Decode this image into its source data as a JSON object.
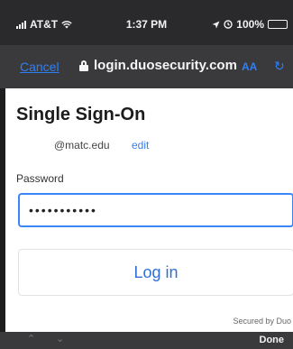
{
  "status_bar": {
    "carrier": "AT&T",
    "time": "1:37 PM",
    "battery": "100%"
  },
  "nav_bar": {
    "cancel_label": "Cancel",
    "url": "login.duosecurity.com",
    "text_size_label": "AA",
    "reload_icon": "↻"
  },
  "form": {
    "title": "Single Sign-On",
    "email": "@matc.edu",
    "edit_label": "edit",
    "password_label": "Password",
    "password_value": "•••••••••••",
    "login_label": "Log in",
    "secured_text": "Secured by Duo"
  },
  "keyboard_toolbar": {
    "prev_icon": "⌃",
    "next_icon": "⌄",
    "done_label": "Done"
  }
}
